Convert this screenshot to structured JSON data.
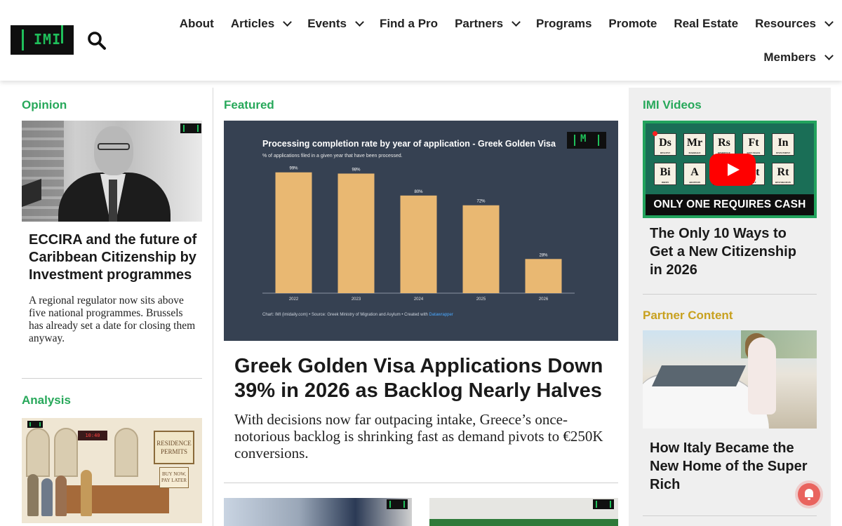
{
  "header": {
    "logo_text": "IMI",
    "nav_row1": [
      {
        "label": "About",
        "dropdown": false
      },
      {
        "label": "Articles",
        "dropdown": true
      },
      {
        "label": "Events",
        "dropdown": true
      },
      {
        "label": "Find a Pro",
        "dropdown": false
      },
      {
        "label": "Partners",
        "dropdown": true
      },
      {
        "label": "Programs",
        "dropdown": false
      },
      {
        "label": "Promote",
        "dropdown": false
      },
      {
        "label": "Real Estate",
        "dropdown": false
      },
      {
        "label": "Resources",
        "dropdown": true
      }
    ],
    "nav_row2": [
      {
        "label": "Members",
        "dropdown": true
      }
    ]
  },
  "opinion": {
    "section_label": "Opinion",
    "headline": "ECCIRA and the future of Caribbean Citizenship by Investment programmes",
    "excerpt": "A regional regulator now sits above five national programmes. Brussels has already set a date for closing them anyway."
  },
  "analysis": {
    "section_label": "Analysis",
    "image_sign_1": "RESIDENCE PERMITS",
    "image_sign_2": "BUY NOW, PAY LATER"
  },
  "featured": {
    "section_label": "Featured",
    "headline": "Greek Golden Visa Applications Down 39% in 2026 as Backlog Nearly Halves",
    "excerpt": "With decisions now far outpacing intake, Greece’s once-notorious backlog is shrinking fast as demand pivots to €250K conversions.",
    "chart_data": {
      "type": "bar",
      "title": "Processing completion rate by year of application - Greek Golden Visa",
      "subtitle": "% of applications filed in a given year that have been processed.",
      "categories": [
        "2022",
        "2023",
        "2024",
        "2025",
        "2026"
      ],
      "values": [
        99,
        98,
        80,
        72,
        28
      ],
      "value_labels": [
        "99%",
        "98%",
        "80%",
        "72%",
        "28%"
      ],
      "ylim": [
        0,
        100
      ],
      "bar_color": "#e9b872",
      "grid": false,
      "footer": "Chart: IMI (imidaily.com) • Source: Greek Ministry of Migration and Asylum • Created with ",
      "footer_link": "Datawrapper"
    }
  },
  "videos": {
    "section_label": "IMI Videos",
    "banner": "ONLY ONE REQUIRES CASH",
    "tiles": [
      {
        "sym": "Ds",
        "word": "DESCENT"
      },
      {
        "sym": "Mr",
        "word": "MARRIAGE"
      },
      {
        "sym": "Rs",
        "word": "RESIDENCE"
      },
      {
        "sym": "Ft",
        "word": "FAST-TRACK"
      },
      {
        "sym": "In",
        "word": "INVESTMENT"
      },
      {
        "sym": "Bi",
        "word": "BIRTH"
      },
      {
        "sym": "A",
        "word": "ADOPTION"
      },
      {
        "sym": "",
        "word": ""
      },
      {
        "sym": "Ct",
        "word": "CITY"
      },
      {
        "sym": "Rt",
        "word": "RESTORATION"
      }
    ],
    "headline": "The Only 10 Ways to Get a New Citizenship in 2026"
  },
  "partner": {
    "section_label": "Partner Content",
    "headline": "How Italy Became the New Home of the Super Rich"
  },
  "colors": {
    "brand_green": "#27a85a",
    "partner_gold": "#c8a11f",
    "chart_bg": "#364152",
    "bar": "#e9b872"
  }
}
